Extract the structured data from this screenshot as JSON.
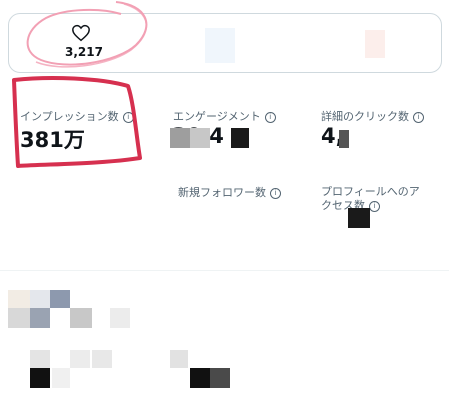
{
  "likes": {
    "count": "3,217",
    "icon": "heart-icon"
  },
  "metrics": {
    "impressions": {
      "label": "インプレッション数",
      "value": "381万"
    },
    "engagements": {
      "label": "エンゲージメント",
      "value": "30.4"
    },
    "detail_clicks": {
      "label": "詳細のクリック数",
      "value": "4,"
    },
    "new_followers": {
      "label": "新規フォロワー数",
      "value": ""
    },
    "profile_visits": {
      "label": "プロフィールへのアクセス数",
      "label_line1": "プロフィールへのア",
      "label_line2": "クセス数",
      "value": ""
    }
  },
  "colors": {
    "annotation_red": "#d6304f",
    "annotation_pink": "#f2a0b4",
    "border": "#cfd9de",
    "text_primary": "#0f1419",
    "text_secondary": "#536471"
  }
}
